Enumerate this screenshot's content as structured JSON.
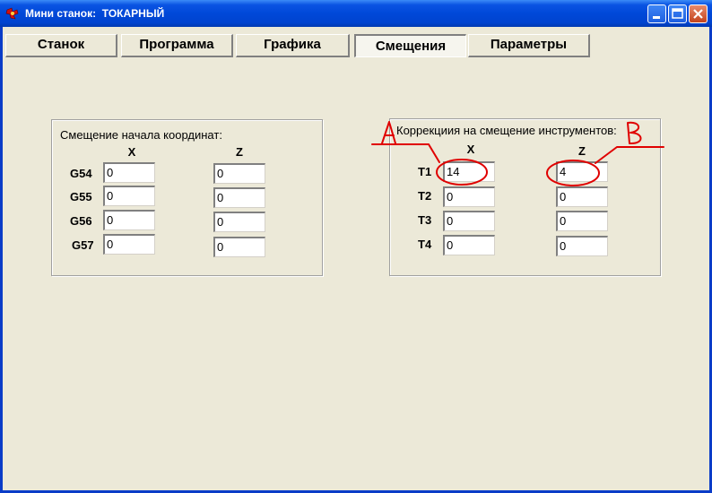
{
  "window": {
    "title": "Мини станок:  ТОКАРНЫЙ"
  },
  "tabs": [
    {
      "label": "Станок"
    },
    {
      "label": "Программа"
    },
    {
      "label": "Графика"
    },
    {
      "label": "Смещения"
    },
    {
      "label": "Параметры"
    }
  ],
  "active_tab": "Смещения",
  "origin_offsets": {
    "title": "Смещение начала координат:",
    "col_x": "X",
    "col_z": "Z",
    "rows": [
      {
        "label": "G54",
        "x": "0",
        "z": "0"
      },
      {
        "label": "G55",
        "x": "0",
        "z": "0"
      },
      {
        "label": "G56",
        "x": "0",
        "z": "0"
      },
      {
        "label": "G57",
        "x": "0",
        "z": "0"
      }
    ]
  },
  "tool_offsets": {
    "title": "Коррекциия на смещение инструментов:",
    "col_x": "X",
    "col_z": "Z",
    "rows": [
      {
        "label": "T1",
        "x": "14",
        "z": "4"
      },
      {
        "label": "T2",
        "x": "0",
        "z": "0"
      },
      {
        "label": "T3",
        "x": "0",
        "z": "0"
      },
      {
        "label": "T4",
        "x": "0",
        "z": "0"
      }
    ]
  },
  "annotations": {
    "label_a": "A",
    "label_b": "B",
    "color": "#e00000"
  },
  "colors": {
    "titlebar": "#0a54e3",
    "face": "#ece9d8"
  }
}
